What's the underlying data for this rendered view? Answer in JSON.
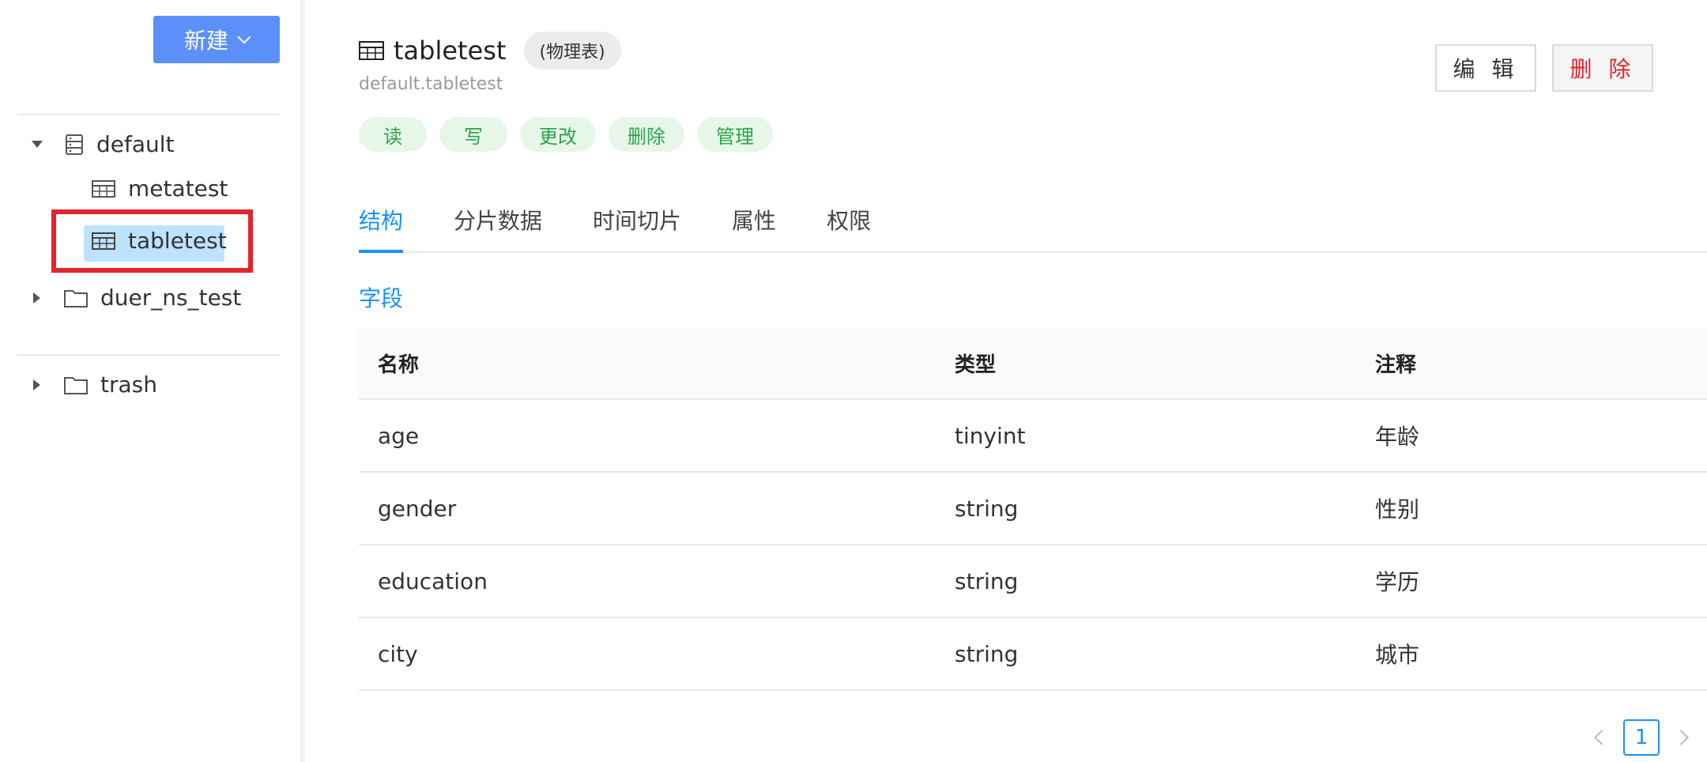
{
  "sidebar": {
    "new_button": "新建",
    "tree": [
      {
        "label": "default",
        "expanded": true,
        "icon": "database-icon"
      },
      {
        "label": "metatest",
        "icon": "table-icon"
      },
      {
        "label": "tabletest",
        "icon": "table-icon",
        "selected": true
      },
      {
        "label": "duer_ns_test",
        "expanded": false,
        "icon": "folder-icon"
      },
      {
        "label": "trash",
        "expanded": false,
        "icon": "folder-icon"
      }
    ]
  },
  "header": {
    "title": "tabletest",
    "type_tag": "(物理表)",
    "subtitle": "default.tabletest",
    "permissions": [
      "读",
      "写",
      "更改",
      "删除",
      "管理"
    ],
    "edit_button": "编 辑",
    "delete_button": "删 除"
  },
  "tabs": [
    "结构",
    "分片数据",
    "时间切片",
    "属性",
    "权限"
  ],
  "section": {
    "title": "字段"
  },
  "table": {
    "columns": [
      "名称",
      "类型",
      "注释"
    ],
    "rows": [
      [
        "age",
        "tinyint",
        "年龄"
      ],
      [
        "gender",
        "string",
        "性别"
      ],
      [
        "education",
        "string",
        "学历"
      ],
      [
        "city",
        "string",
        "城市"
      ]
    ]
  },
  "pagination": {
    "current": "1"
  },
  "colors": {
    "primary": "#1890ff",
    "button_blue": "#5b8ff9",
    "danger": "#e3242b",
    "tag_green": "#2ea24a",
    "selection": "#bde3ff"
  }
}
